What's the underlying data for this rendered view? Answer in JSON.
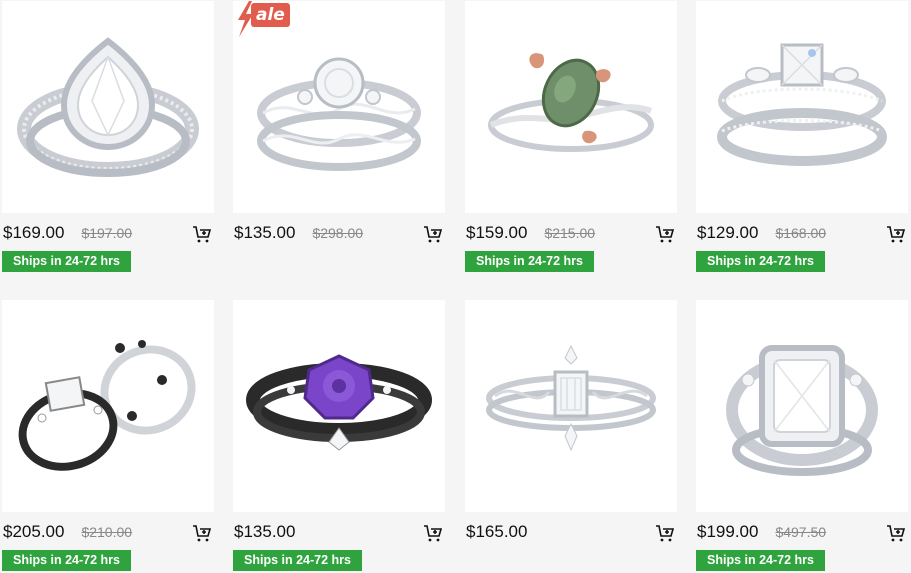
{
  "sale_badge": {
    "label": "ale"
  },
  "products": [
    {
      "price": "$169.00",
      "original_price": "$197.00",
      "shipping": "Ships in 24-72 hrs",
      "ring": "pear-halo-silver",
      "sale": false
    },
    {
      "price": "$135.00",
      "original_price": "$298.00",
      "shipping": "",
      "ring": "twist-bridal-silver",
      "sale": true
    },
    {
      "price": "$159.00",
      "original_price": "$215.00",
      "shipping": "Ships in 24-72 hrs",
      "ring": "moss-agate-leaf",
      "sale": false
    },
    {
      "price": "$129.00",
      "original_price": "$168.00",
      "shipping": "Ships in 24-72 hrs",
      "ring": "princess-bridal-silver",
      "sale": false
    },
    {
      "price": "$205.00",
      "original_price": "$210.00",
      "shipping": "Ships in 24-72 hrs",
      "ring": "black-white-set",
      "sale": false
    },
    {
      "price": "$135.00",
      "original_price": "",
      "shipping": "Ships in 24-72 hrs",
      "ring": "purple-rose-black",
      "sale": false
    },
    {
      "price": "$165.00",
      "original_price": "",
      "shipping": "",
      "ring": "emerald-cut-vintage",
      "sale": false
    },
    {
      "price": "$199.00",
      "original_price": "$497.50",
      "shipping": "Ships in 24-72 hrs",
      "ring": "radiant-halo-silver",
      "sale": false
    }
  ],
  "colors": {
    "ship_badge": "#2fa33d",
    "sale_badge": "#e25c4d",
    "silver": "#c9ccd2",
    "black_metal": "#2a2a2a",
    "purple_gem": "#7a45c8",
    "moss_gem": "#6f8f6a",
    "rose_gold": "#d9957a"
  }
}
